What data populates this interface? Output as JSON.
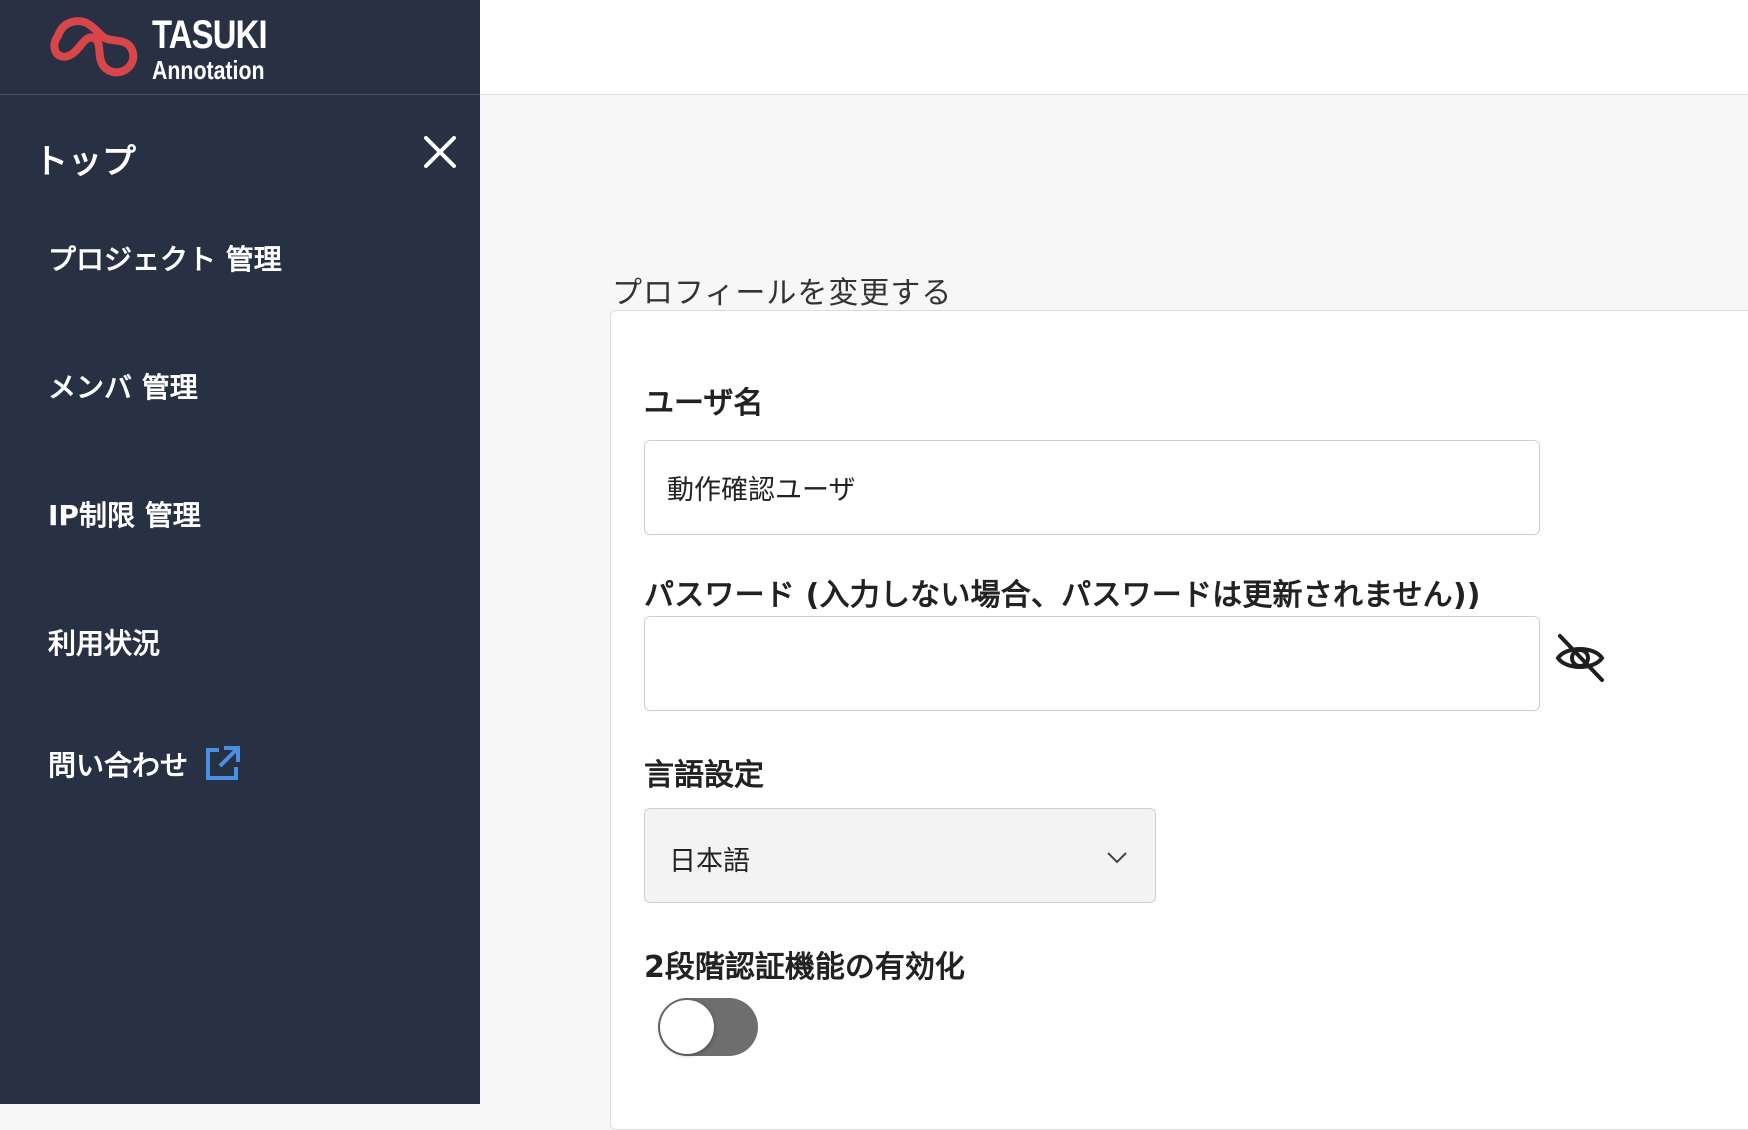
{
  "app": {
    "logo_title": "TASUKI",
    "logo_subtitle": "Annotation",
    "brand_color": "#d9464a"
  },
  "sidebar": {
    "top_label": "トップ",
    "items": [
      {
        "label": "プロジェクト 管理"
      },
      {
        "label": "メンバ 管理"
      },
      {
        "label": "IP制限 管理"
      },
      {
        "label": "利用状況"
      },
      {
        "label": "問い合わせ",
        "icon": "external-link-icon"
      }
    ],
    "background_color": "#283044",
    "link_icon_color": "#4a90e2"
  },
  "profile": {
    "section_title": "プロフィールを変更する",
    "username": {
      "label": "ユーザ名",
      "value": "動作確認ユーザ"
    },
    "password": {
      "label": "パスワード (入力しない場合、パスワードは更新されません))",
      "value": "",
      "toggle_icon": "eye-slash-icon"
    },
    "language": {
      "label": "言語設定",
      "selected": "日本語"
    },
    "two_factor": {
      "label": "2段階認証機能の有効化",
      "enabled": false
    }
  }
}
